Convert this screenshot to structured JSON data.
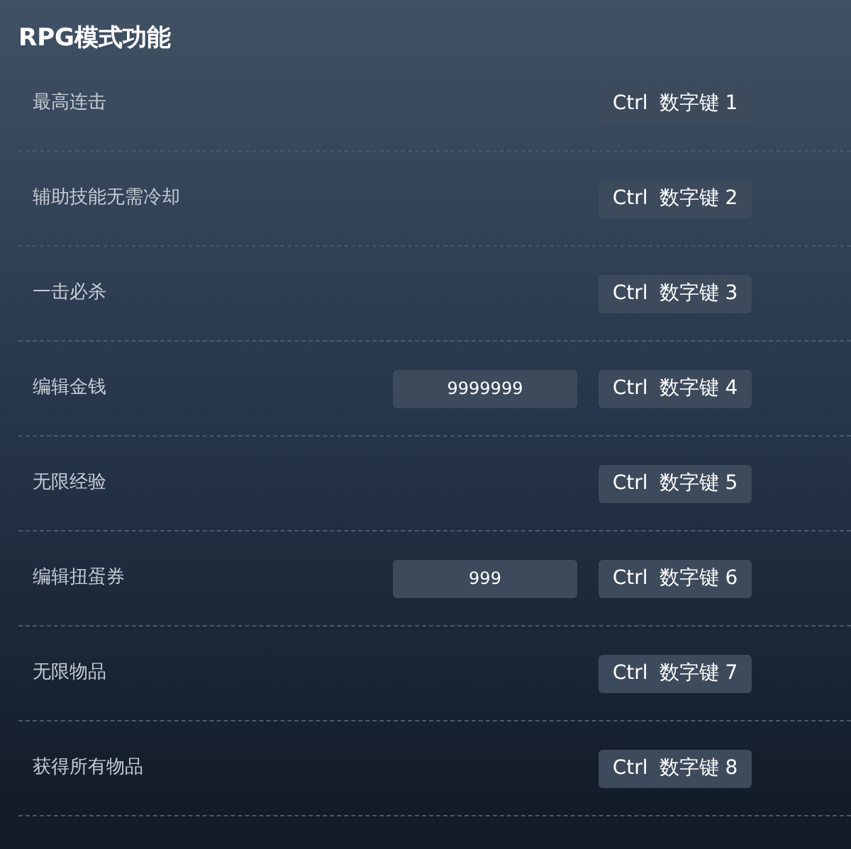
{
  "title": "RPG模式功能",
  "rows": [
    {
      "kind": "toggle",
      "label": "最高连击",
      "hotkey": [
        "Ctrl",
        "数字键 1"
      ]
    },
    {
      "kind": "toggle",
      "label": "辅助技能无需冷却",
      "hotkey": [
        "Ctrl",
        "数字键 2"
      ]
    },
    {
      "kind": "toggle",
      "label": "一击必杀",
      "hotkey": [
        "Ctrl",
        "数字键 3"
      ]
    },
    {
      "kind": "input",
      "label": "编辑金钱",
      "value": "9999999",
      "hotkey": [
        "Ctrl",
        "数字键 4"
      ]
    },
    {
      "kind": "toggle",
      "label": "无限经验",
      "hotkey": [
        "Ctrl",
        "数字键 5"
      ]
    },
    {
      "kind": "input",
      "label": "编辑扭蛋券",
      "value": "999",
      "hotkey": [
        "Ctrl",
        "数字键 6"
      ]
    },
    {
      "kind": "toggle",
      "label": "无限物品",
      "hotkey": [
        "Ctrl",
        "数字键 7"
      ]
    },
    {
      "kind": "toggle",
      "label": "获得所有物品",
      "hotkey": [
        "Ctrl",
        "数字键 8"
      ]
    }
  ]
}
